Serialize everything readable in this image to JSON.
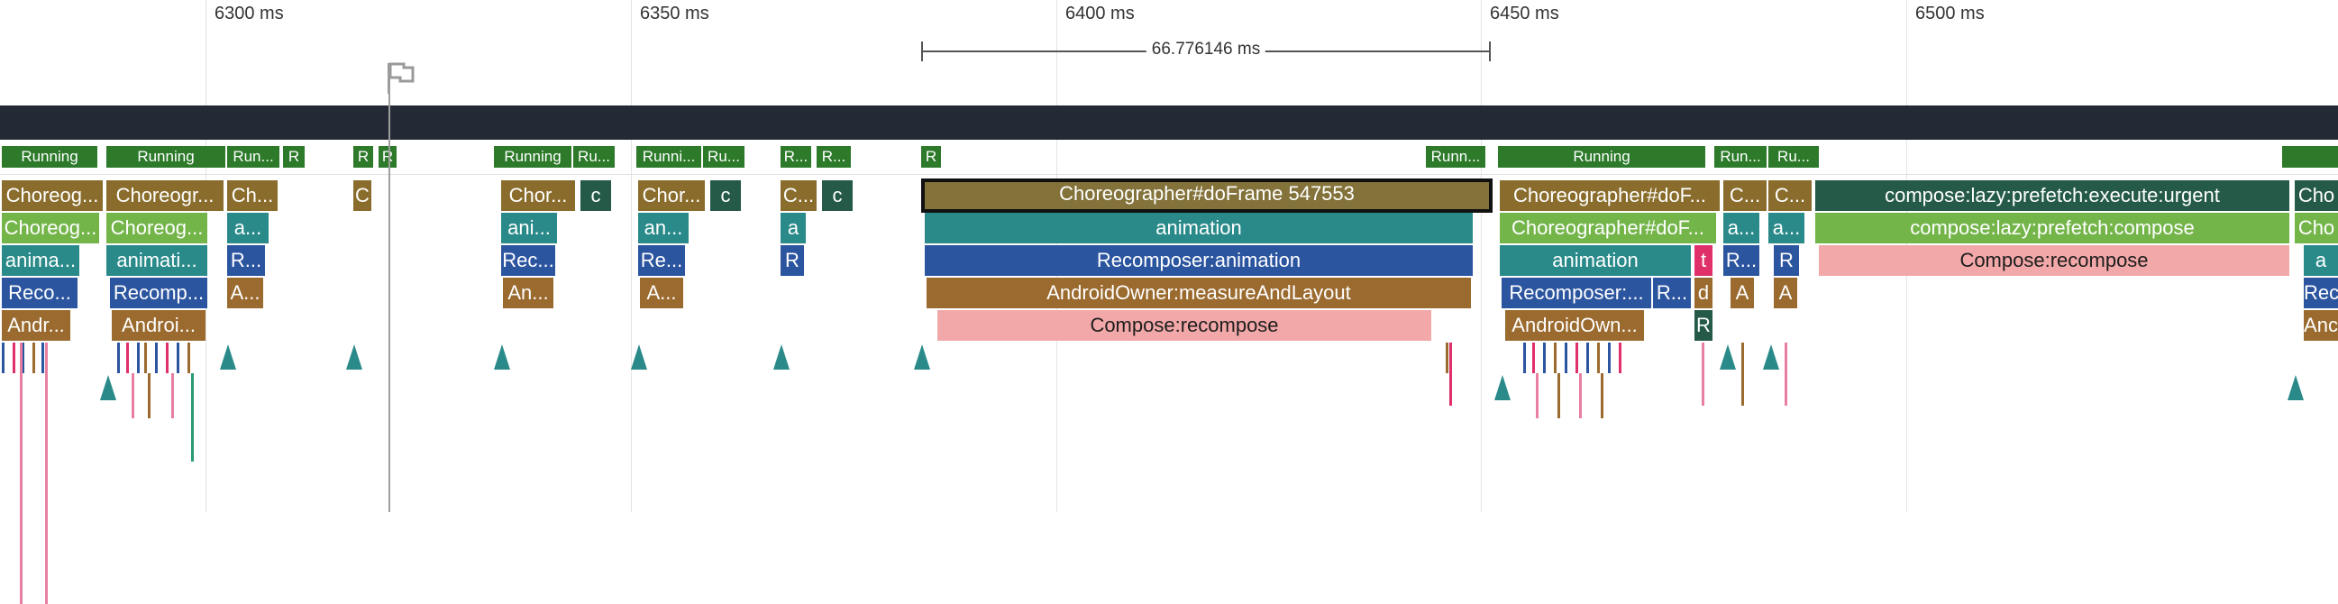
{
  "timeline": {
    "ticks": [
      "6300 ms",
      "6350 ms",
      "6400 ms",
      "6450 ms",
      "6500 ms"
    ],
    "measurement": "66.776146 ms"
  },
  "thread_states": [
    "Running",
    "Running",
    "Run...",
    "R",
    "R",
    "R",
    "Running",
    "Ru...",
    "Runni...",
    "Ru...",
    "R...",
    "R...",
    "R",
    "Runn...",
    "Running",
    "Run...",
    "Ru..."
  ],
  "slices": [
    {
      "label": "Choreog...",
      "color": "#8a6d2c"
    },
    {
      "label": "Choreogr...",
      "color": "#8a6d2c"
    },
    {
      "label": "Ch...",
      "color": "#8a6d2c"
    },
    {
      "label": "C",
      "color": "#8a6d2c"
    },
    {
      "label": "Chor...",
      "color": "#8a6d2c"
    },
    {
      "label": "c",
      "color": "#255a49"
    },
    {
      "label": "Chor...",
      "color": "#8a6d2c"
    },
    {
      "label": "c",
      "color": "#255a49"
    },
    {
      "label": "C...",
      "color": "#8a6d2c"
    },
    {
      "label": "c",
      "color": "#255a49"
    },
    {
      "label": "Choreographer#doFrame 547553",
      "color": "#837239"
    },
    {
      "label": "Choreographer#doF...",
      "color": "#8a6d2c"
    },
    {
      "label": "C...",
      "color": "#8a6d2c"
    },
    {
      "label": "C...",
      "color": "#8a6d2c"
    },
    {
      "label": "compose:lazy:prefetch:execute:urgent",
      "color": "#255a49"
    },
    {
      "label": "Cho",
      "color": "#255a49"
    },
    {
      "label": "Choreog...",
      "color": "#74b54a"
    },
    {
      "label": "Choreog...",
      "color": "#74b54a"
    },
    {
      "label": "a...",
      "color": "#2a8a8a"
    },
    {
      "label": "ani...",
      "color": "#2a8a8a"
    },
    {
      "label": "an...",
      "color": "#2a8a8a"
    },
    {
      "label": "a",
      "color": "#2a8a8a"
    },
    {
      "label": "animation",
      "color": "#2a8a8a"
    },
    {
      "label": "Choreographer#doF...",
      "color": "#74b54a"
    },
    {
      "label": "a...",
      "color": "#2a8a8a"
    },
    {
      "label": "a...",
      "color": "#2a8a8a"
    },
    {
      "label": "compose:lazy:prefetch:compose",
      "color": "#74b54a"
    },
    {
      "label": "Cho",
      "color": "#74b54a"
    },
    {
      "label": "anima...",
      "color": "#2a8a8a"
    },
    {
      "label": "animati...",
      "color": "#2a8a8a"
    },
    {
      "label": "R...",
      "color": "#2c55a0"
    },
    {
      "label": "Rec...",
      "color": "#2c55a0"
    },
    {
      "label": "Re...",
      "color": "#2c55a0"
    },
    {
      "label": "R",
      "color": "#2c55a0"
    },
    {
      "label": "Recomposer:animation",
      "color": "#2c55a0"
    },
    {
      "label": "animation",
      "color": "#2a8a8a"
    },
    {
      "label": "t",
      "color": "#e0306a"
    },
    {
      "label": "R...",
      "color": "#2c55a0"
    },
    {
      "label": "R",
      "color": "#2c55a0"
    },
    {
      "label": "Compose:recompose",
      "color": "#f2a8a8"
    },
    {
      "label": "a",
      "color": "#2a8a8a"
    },
    {
      "label": "Reco...",
      "color": "#2c55a0"
    },
    {
      "label": "Recomp...",
      "color": "#2c55a0"
    },
    {
      "label": "A...",
      "color": "#9a6a2e"
    },
    {
      "label": "An...",
      "color": "#9a6a2e"
    },
    {
      "label": "A...",
      "color": "#9a6a2e"
    },
    {
      "label": "AndroidOwner:measureAndLayout",
      "color": "#9a6a2e"
    },
    {
      "label": "Recomposer:...",
      "color": "#2c55a0"
    },
    {
      "label": "R...",
      "color": "#2c55a0"
    },
    {
      "label": "d",
      "color": "#9a6a2e"
    },
    {
      "label": "A",
      "color": "#9a6a2e"
    },
    {
      "label": "A",
      "color": "#9a6a2e"
    },
    {
      "label": "Reco",
      "color": "#2c55a0"
    },
    {
      "label": "Andr...",
      "color": "#9a6a2e"
    },
    {
      "label": "Androi...",
      "color": "#9a6a2e"
    },
    {
      "label": "Compose:recompose",
      "color": "#f2a8a8"
    },
    {
      "label": "AndroidOwn...",
      "color": "#9a6a2e"
    },
    {
      "label": "R",
      "color": "#255a49"
    },
    {
      "label": "Anc",
      "color": "#9a6a2e"
    }
  ],
  "colors": {
    "running_state": "#2c7a2a",
    "header_band": "#232a35",
    "choreographer": "#8a6d2c",
    "animation": "#2a8a8a",
    "recomposer": "#2c55a0",
    "android_owner": "#9a6a2e",
    "compose_recompose": "#f2a8a8",
    "prefetch_urgent": "#255a49",
    "prefetch_compose": "#74b54a",
    "instant_marker": "#2a8a8a"
  },
  "icons": [
    "flag-icon",
    "instant-event-arrow-icon"
  ]
}
